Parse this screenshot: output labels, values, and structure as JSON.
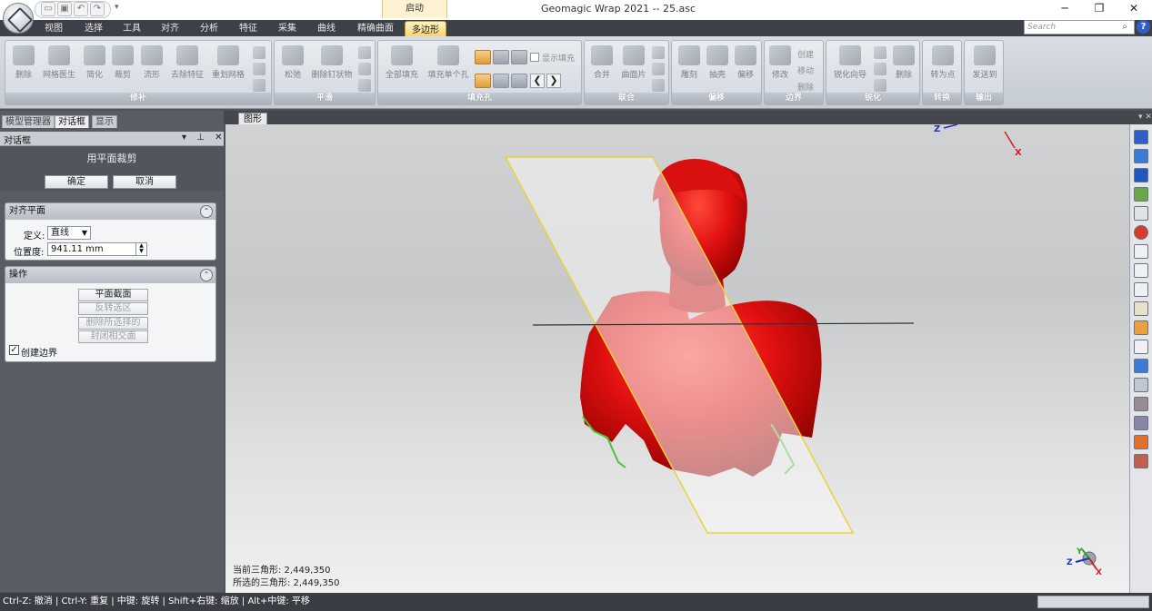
{
  "window": {
    "title": "Geomagic Wrap 2021 -- 25.asc",
    "context_tab": "启动"
  },
  "menu": {
    "tabs": [
      "视图",
      "选择",
      "工具",
      "对齐",
      "分析",
      "特征",
      "采集",
      "曲线",
      "精确曲面",
      "多边形"
    ],
    "active": "多边形"
  },
  "search": {
    "placeholder": "Search"
  },
  "ribbon": {
    "groups": {
      "repair": {
        "label": "修补",
        "buttons": [
          "删除",
          "网格医生",
          "简化",
          "裁剪",
          "流形",
          "去除特征",
          "重划网格"
        ]
      },
      "smooth": {
        "label": "平滑",
        "buttons": [
          "松弛",
          "删除钉状物"
        ]
      },
      "fill": {
        "label": "填充孔",
        "buttons": [
          "全部填充",
          "填充单个孔"
        ],
        "checkbox": "显示填充"
      },
      "combine": {
        "label": "联合",
        "buttons": [
          "合并",
          "曲面片"
        ]
      },
      "offset": {
        "label": "偏移",
        "buttons": [
          "雕刻",
          "抽壳",
          "偏移"
        ]
      },
      "boundary": {
        "label": "边界",
        "buttons": [
          "修改"
        ],
        "items": [
          "创建",
          "移动",
          "删除"
        ]
      },
      "sharpen": {
        "label": "锐化",
        "buttons": [
          "锐化向导",
          "删除"
        ]
      },
      "convert": {
        "label": "转换",
        "buttons": [
          "转为点"
        ]
      },
      "output": {
        "label": "输出",
        "buttons": [
          "发送到"
        ]
      }
    }
  },
  "panel": {
    "tabs": [
      "模型管理器",
      "对话框",
      "显示"
    ],
    "header": "对话框",
    "op_title": "用平面裁剪",
    "ok": "确定",
    "cancel": "取消",
    "align_section": {
      "title": "对齐平面",
      "define_label": "定义:",
      "define_value": "直线",
      "position_label": "位置度:",
      "position_value": "941.11 mm"
    },
    "ops_section": {
      "title": "操作",
      "buttons": [
        "平面截面",
        "反转选区",
        "删除所选择的",
        "封闭相交面"
      ],
      "checkbox_label": "创建边界",
      "checkbox_checked": true
    }
  },
  "viewport": {
    "tab": "图形",
    "tri_current": "当前三角形: 2,449,350",
    "tri_selected": "所选的三角形: 2,449,350",
    "axis_z": "Z",
    "axis_x": "X",
    "axis_y": "Y"
  },
  "status": {
    "hint": "Ctrl-Z: 撤消 | Ctrl-Y: 重复 | 中键: 旋转 | Shift+右键: 缩放 | Alt+中键: 平移"
  },
  "colors": {
    "model": "#e01010",
    "plane_edge": "#e8d23a",
    "accent_tab": "#f5d26a"
  }
}
